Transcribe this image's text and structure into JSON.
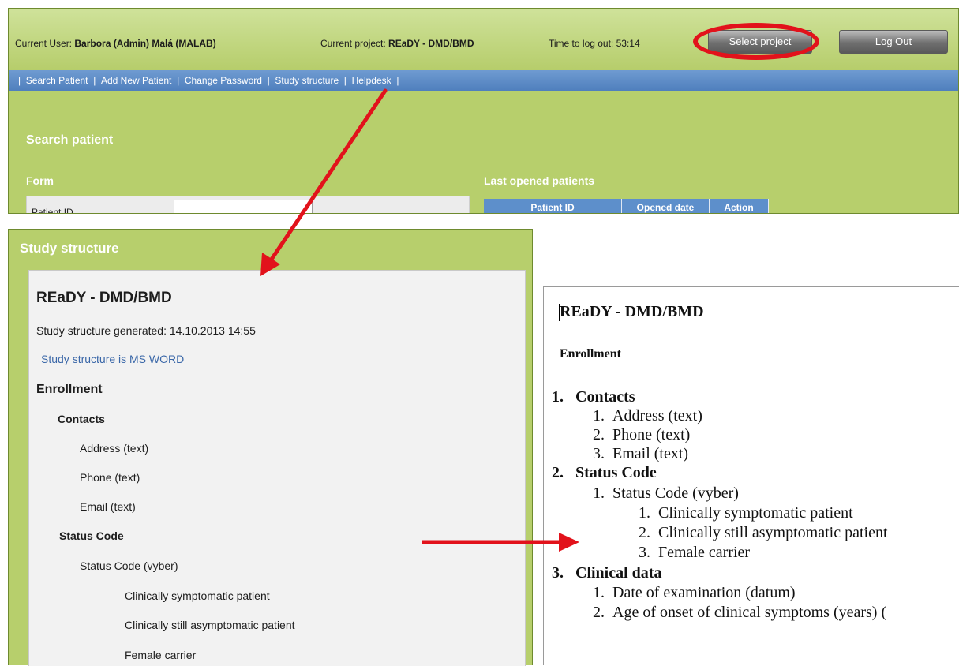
{
  "header": {
    "user_label": "Current User:",
    "user_name": "Barbora (Admin) Malá (MALAB)",
    "project_label": "Current project:",
    "project_name": "REaDY - DMD/BMD",
    "logout_timer": "Time to log out: 53:14",
    "select_project_button": "Select project",
    "logout_button": "Log Out"
  },
  "nav": {
    "items": [
      "Search Patient",
      "Add New Patient",
      "Change Password",
      "Study structure",
      "Helpdesk"
    ]
  },
  "search": {
    "title": "Search patient",
    "form_title": "Form",
    "patient_id_label": "Patient ID",
    "last_opened_title": "Last opened patients",
    "columns": [
      "Patient ID",
      "Opened date",
      "Action"
    ]
  },
  "study": {
    "panel_title": "Study structure",
    "project_title": "REaDY - DMD/BMD",
    "generated": "Study structure generated: 14.10.2013 14:55",
    "word_link": "Study structure is MS WORD",
    "section": "Enrollment",
    "contacts": "Contacts",
    "address": "Address (text)",
    "phone": "Phone  (text)",
    "email": "Email (text)",
    "status_code": "Status Code",
    "status_code_field": "Status Code (vyber)",
    "opt1": "Clinically symptomatic patient",
    "opt2": "Clinically still asymptomatic patient",
    "opt3": "Female carrier"
  },
  "word": {
    "title": "REaDY - DMD/BMD",
    "section": "Enrollment",
    "lines": [
      {
        "num": "1.",
        "text": "Contacts"
      },
      {
        "num": "1.",
        "text": "Address (text)"
      },
      {
        "num": "2.",
        "text": "Phone  (text)"
      },
      {
        "num": "3.",
        "text": "Email (text)"
      },
      {
        "num": "2.",
        "text": "Status Code"
      },
      {
        "num": "1.",
        "text": "Status Code (vyber)"
      },
      {
        "num": "1.",
        "text": "Clinically symptomatic patient"
      },
      {
        "num": "2.",
        "text": "Clinically still asymptomatic patient"
      },
      {
        "num": "3.",
        "text": "Female carrier"
      },
      {
        "num": "3.",
        "text": "Clinical data"
      },
      {
        "num": "1.",
        "text": "Date of examination (datum)"
      },
      {
        "num": "2.",
        "text": "Age of onset of clinical symptoms (years) ("
      }
    ]
  },
  "colors": {
    "header_green": "#b7cf6c",
    "nav_blue": "#5d8fcb",
    "highlight_red": "#e2121b",
    "link_blue": "#3a67a8"
  }
}
